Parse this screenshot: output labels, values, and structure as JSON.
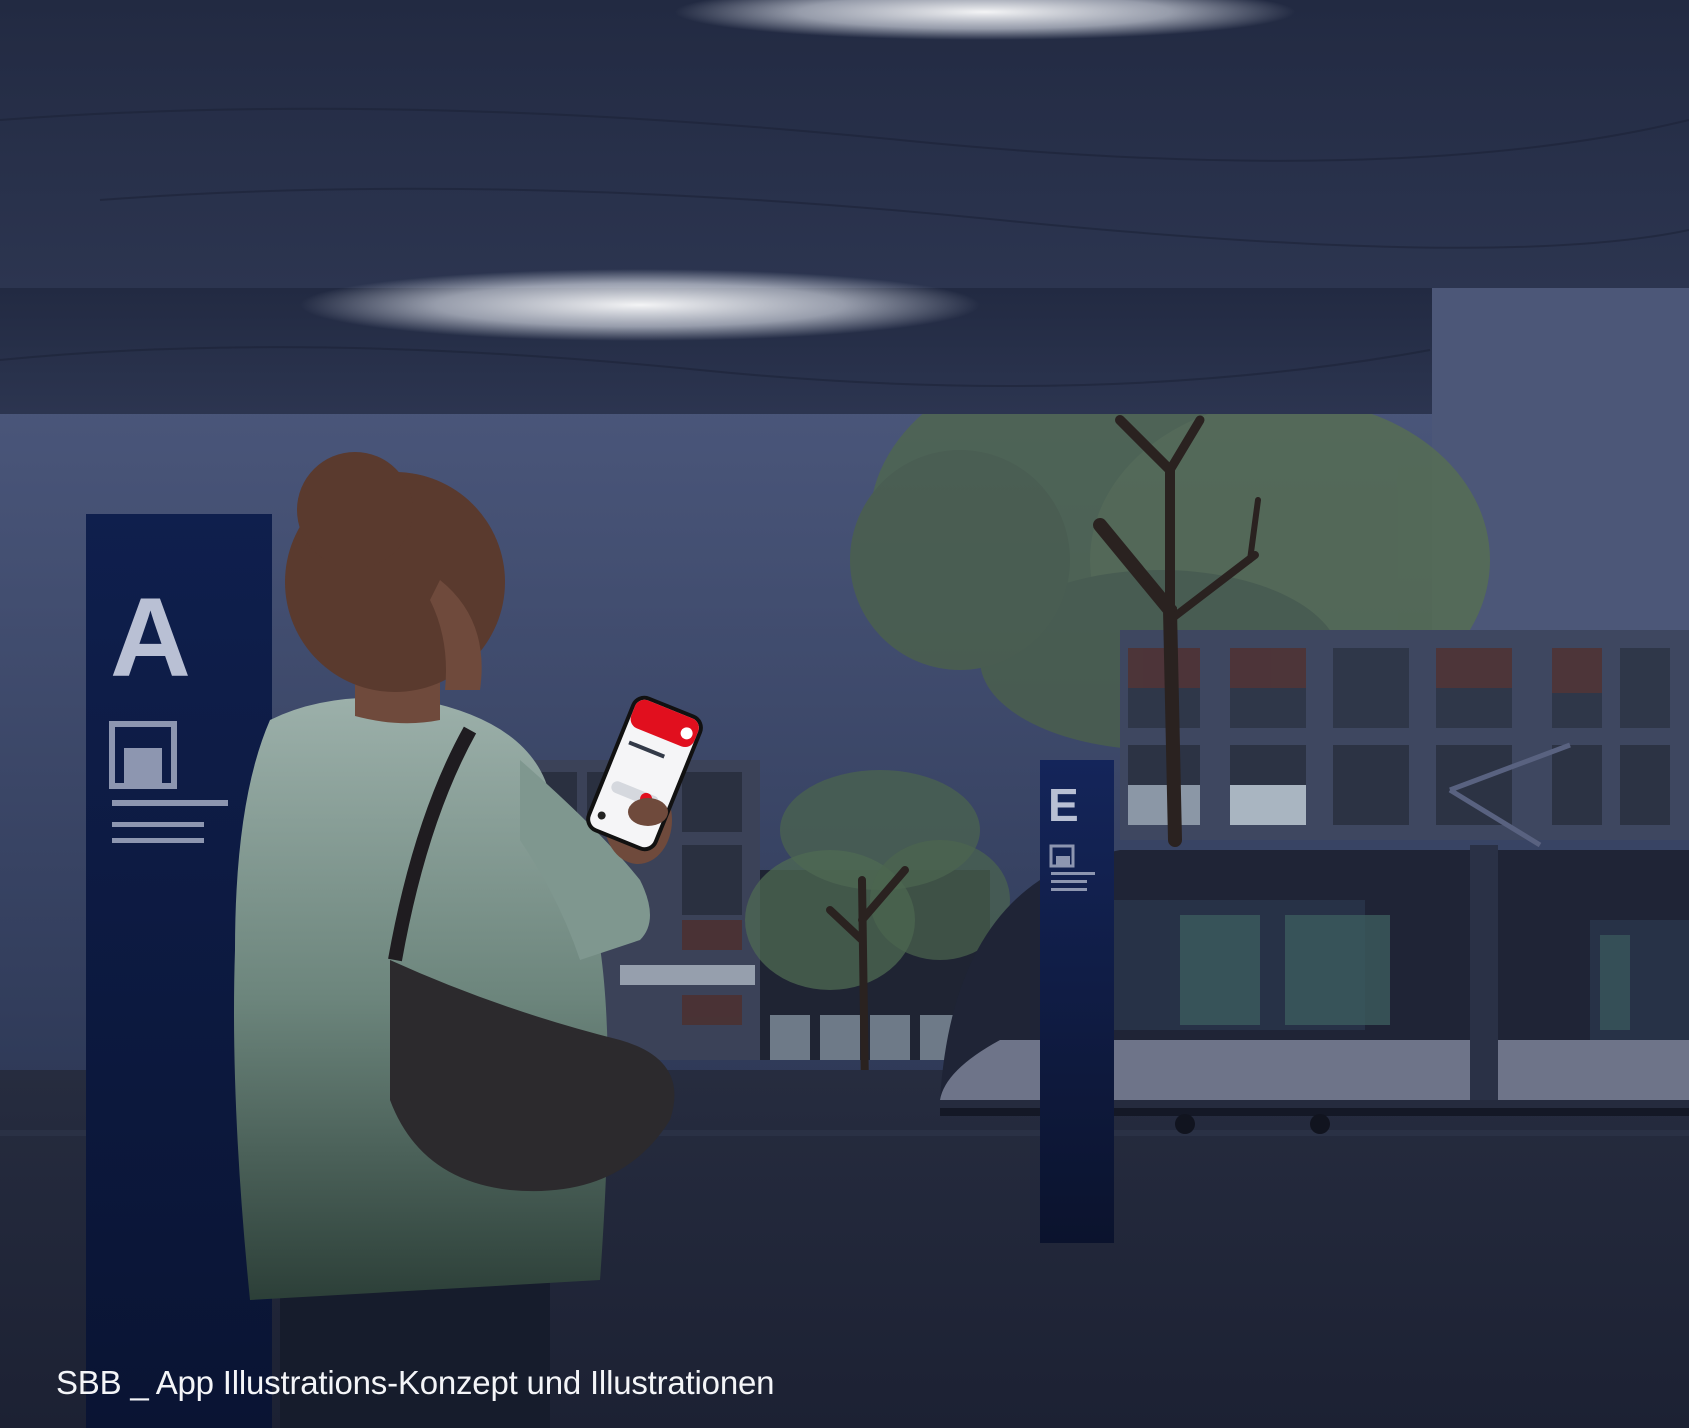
{
  "signs": {
    "platform_a": {
      "letter": "A"
    },
    "platform_e": {
      "letter": "E"
    }
  },
  "caption": "SBB _ App Illustrations-Konzept und Illustrationen",
  "colors": {
    "sky": "#3a4666",
    "roof": "#252d45",
    "sign_blue": "#0f1f4d",
    "app_red": "#e10f1e",
    "coat": "#6f8a82",
    "hair": "#5a3a2e",
    "tree": "#55694f"
  }
}
